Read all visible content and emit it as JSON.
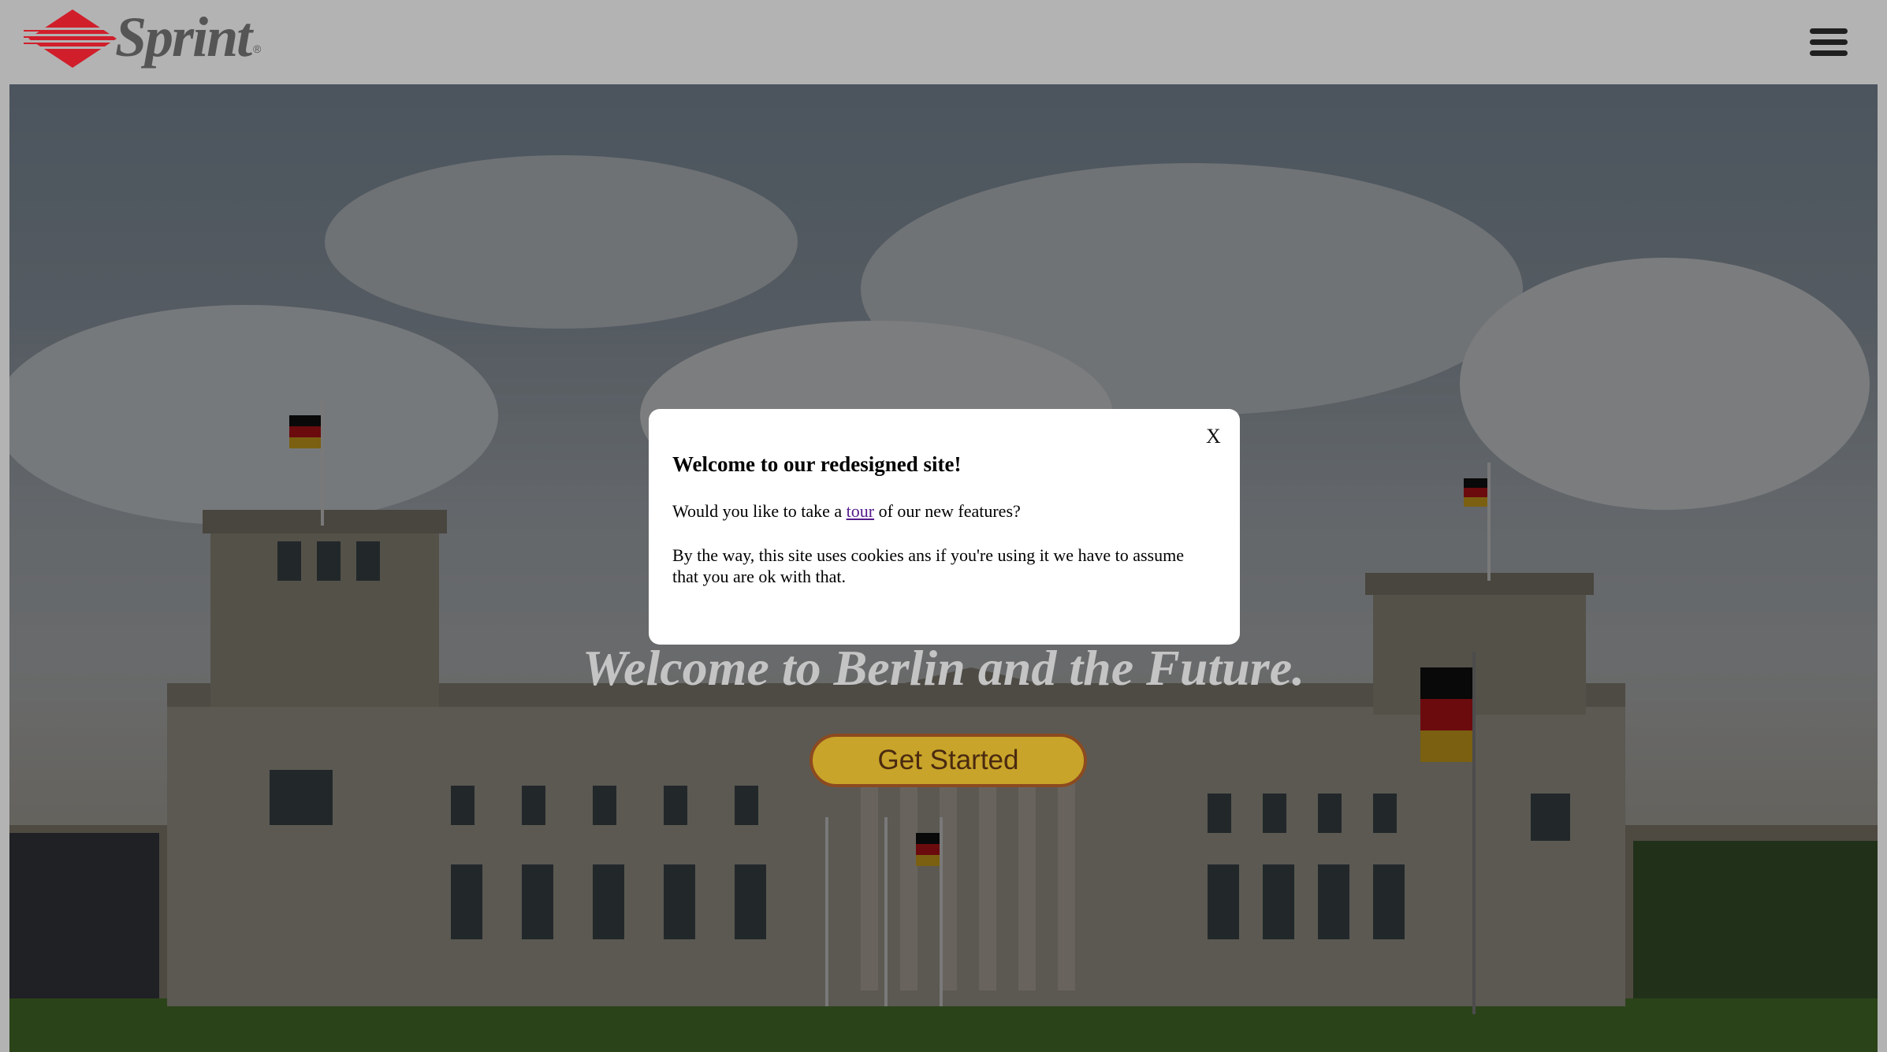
{
  "header": {
    "logo_text": "Sprint",
    "logo_registered": "®",
    "menu_icon": "hamburger-menu-icon"
  },
  "hero": {
    "title": "Welcome to Berlin and the Future.",
    "cta_label": "Get Started"
  },
  "modal": {
    "close_label": "X",
    "title": "Welcome to our redesigned site!",
    "tour_prefix": "Would you like to take a ",
    "tour_link": "tour",
    "tour_suffix": " of our new features?",
    "cookie_text": "By the way, this site uses cookies ans if you're using it we have to assume that you are ok with that."
  },
  "colors": {
    "header_bg": "#b3b3b3",
    "cta_bg": "#c8a42a",
    "cta_border": "#8c4a20",
    "logo_red": "#d01f2b",
    "link": "#551a8b"
  }
}
